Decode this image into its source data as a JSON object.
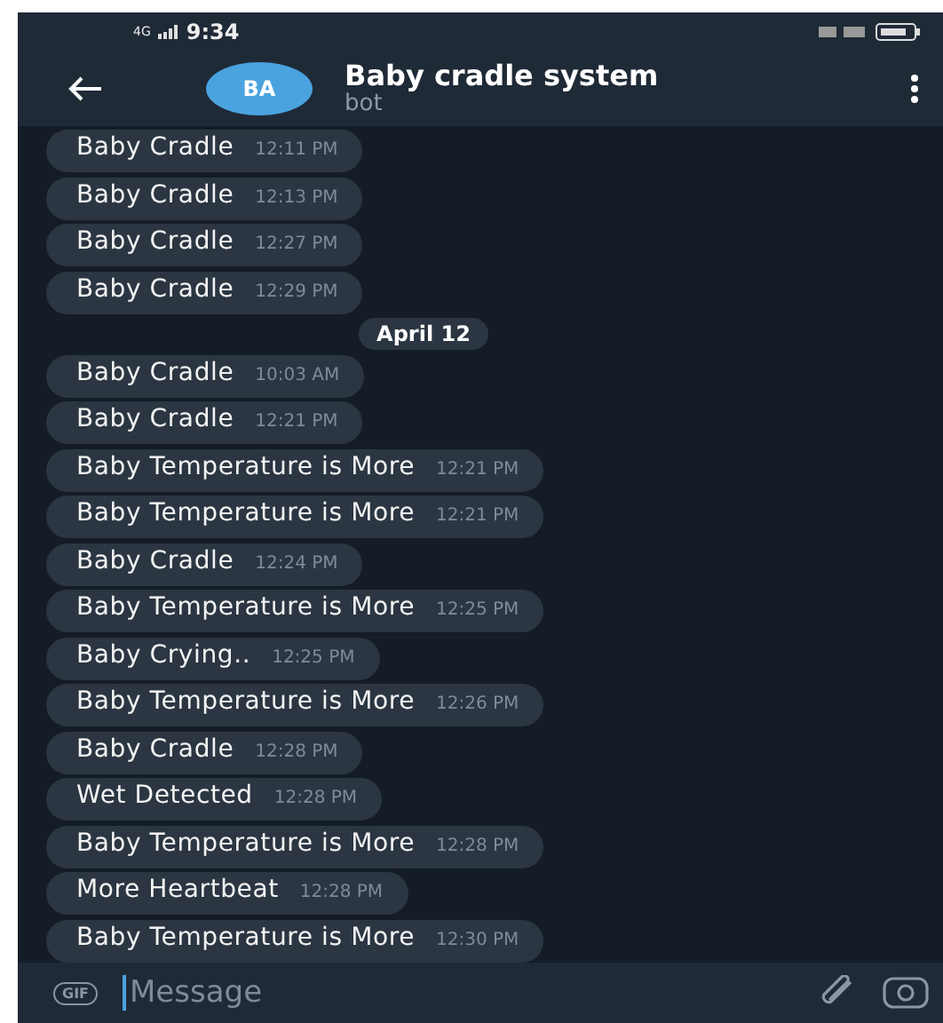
{
  "status_bar": {
    "network": "4G",
    "time": "9:34"
  },
  "header": {
    "avatar": "BA",
    "title": "Baby cradle system",
    "subtitle": "bot"
  },
  "messages": [
    {
      "kind": "message",
      "text": "Baby Cradle",
      "time": "12:11 PM"
    },
    {
      "kind": "message",
      "text": "Baby Cradle",
      "time": "12:13 PM"
    },
    {
      "kind": "message",
      "text": "Baby Cradle",
      "time": "12:27 PM"
    },
    {
      "kind": "message",
      "text": "Baby Cradle",
      "time": "12:29 PM"
    },
    {
      "kind": "date",
      "text": "April 12"
    },
    {
      "kind": "message",
      "text": "Baby Cradle",
      "time": "10:03 AM"
    },
    {
      "kind": "message",
      "text": "Baby Cradle",
      "time": "12:21 PM"
    },
    {
      "kind": "message",
      "text": "Baby Temperature is More",
      "time": "12:21 PM"
    },
    {
      "kind": "message",
      "text": "Baby Temperature is More",
      "time": "12:21 PM"
    },
    {
      "kind": "message",
      "text": "Baby Cradle",
      "time": "12:24 PM"
    },
    {
      "kind": "message",
      "text": "Baby Temperature is More",
      "time": "12:25 PM"
    },
    {
      "kind": "message",
      "text": "Baby Crying..",
      "time": "12:25 PM"
    },
    {
      "kind": "message",
      "text": "Baby Temperature is More",
      "time": "12:26 PM"
    },
    {
      "kind": "message",
      "text": "Baby Cradle",
      "time": "12:28 PM"
    },
    {
      "kind": "message",
      "text": "Wet Detected",
      "time": "12:28 PM"
    },
    {
      "kind": "message",
      "text": "Baby Temperature is More",
      "time": "12:28 PM"
    },
    {
      "kind": "message",
      "text": "More Heartbeat",
      "time": "12:28 PM"
    },
    {
      "kind": "message",
      "text": "Baby Temperature is More",
      "time": "12:30 PM"
    }
  ],
  "composer": {
    "gif": "GIF",
    "placeholder": "Message"
  }
}
